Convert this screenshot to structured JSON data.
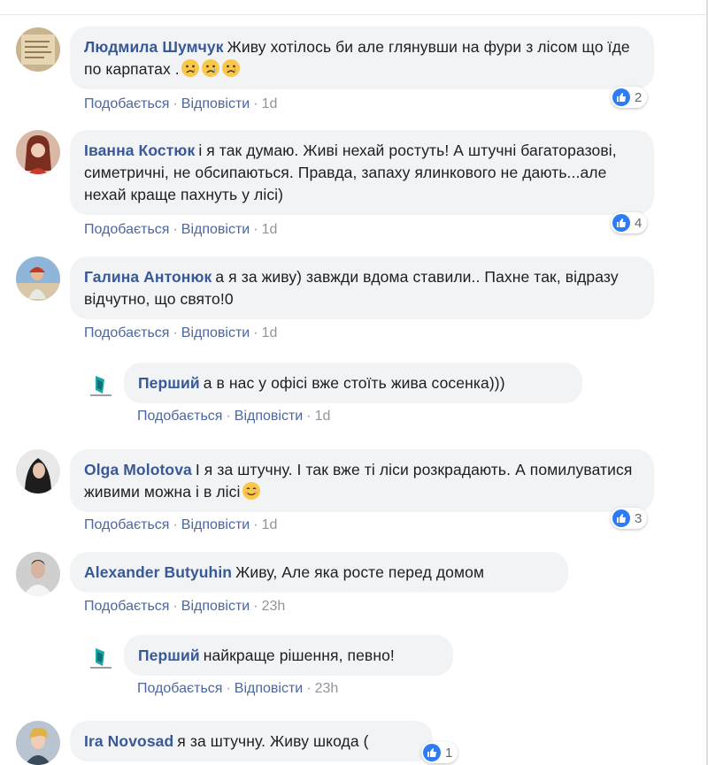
{
  "labels": {
    "like": "Подобається",
    "reply": "Відповісти",
    "dot": "·"
  },
  "colors": {
    "name": "#385898",
    "bubble": "#f2f3f5",
    "like": "#2d7cf6"
  },
  "comments": [
    {
      "author": "Людмила Шумчук",
      "text": "Живу хотілось би але глянувши на фури з лісом що їде по карпатах .",
      "emojis": [
        "sad-face-icon",
        "sad-face-icon",
        "sad-face-icon"
      ],
      "time": "1d",
      "reactions": "2"
    },
    {
      "author": "Іванна Костюк",
      "text": "і я так думаю. Живі нехай ростуть! А штучні багаторазові, симетричні, не обсипаються. Правда, запаху ялинкового не дають...але нехай краще пахнуть у лісі)",
      "time": "1d",
      "reactions": "4"
    },
    {
      "author": "Галина Антонюк",
      "text": "а я за живу) завжди вдома ставили.. Пахне так, відразу відчутно, що свято!0",
      "time": "1d"
    },
    {
      "author": "Перший",
      "text": "а в нас у офісі вже стоїть жива сосенка)))",
      "time": "1d"
    },
    {
      "author": "Olga Molotova",
      "text": "І я за штучну. І так вже ті ліси розкрадають. А помилуватися живими можна і в лісі",
      "emojis": [
        "smile-face-icon"
      ],
      "time": "1d",
      "reactions": "3"
    },
    {
      "author": "Alexander Butyuhin",
      "text": "Живу, Але яка росте перед домом",
      "time": "23h"
    },
    {
      "author": "Перший",
      "text": "найкраще рішення, певно!",
      "time": "23h"
    },
    {
      "author": "Ira Novosad",
      "text": "я за штучну. Живу шкода (",
      "reactions": "1"
    }
  ]
}
